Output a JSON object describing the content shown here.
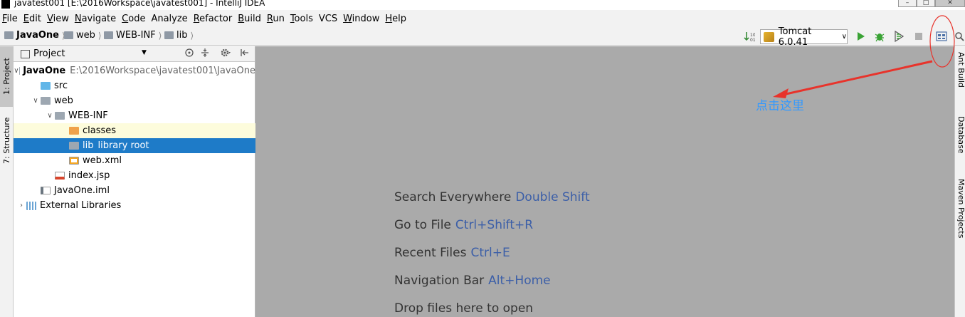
{
  "window": {
    "title": "javatest001 [E:\\2016Workspace\\javatest001] - IntelliJ IDEA"
  },
  "menu": [
    {
      "label": "File",
      "mnemonic": "F",
      "rest": "ile"
    },
    {
      "label": "Edit",
      "mnemonic": "E",
      "rest": "dit"
    },
    {
      "label": "View",
      "mnemonic": "V",
      "rest": "iew"
    },
    {
      "label": "Navigate",
      "mnemonic": "N",
      "rest": "avigate"
    },
    {
      "label": "Code",
      "mnemonic": "C",
      "rest": "ode"
    },
    {
      "label": "Analyze",
      "mnemonic": "",
      "rest": "Analyze"
    },
    {
      "label": "Refactor",
      "mnemonic": "R",
      "rest": "efactor"
    },
    {
      "label": "Build",
      "mnemonic": "B",
      "rest": "uild"
    },
    {
      "label": "Run",
      "mnemonic": "R",
      "rest": "un"
    },
    {
      "label": "Tools",
      "mnemonic": "T",
      "rest": "ools"
    },
    {
      "label": "VCS",
      "mnemonic": "",
      "rest": "VCS"
    },
    {
      "label": "Window",
      "mnemonic": "W",
      "rest": "indow"
    },
    {
      "label": "Help",
      "mnemonic": "H",
      "rest": "elp"
    }
  ],
  "breadcrumb": [
    "JavaOne",
    "web",
    "WEB-INF",
    "lib"
  ],
  "run_config": {
    "label": "Tomcat 6.0.41"
  },
  "left_tabs": [
    "1: Project",
    "7: Structure"
  ],
  "right_tabs": [
    "Ant Build",
    "Database",
    "Maven Projects"
  ],
  "project_panel": {
    "title": "Project",
    "tree": [
      {
        "label": "JavaOne",
        "extra": "E:\\2016Workspace\\javatest001\\JavaOne",
        "depth": 0,
        "arrow": "down",
        "icon": "module-folder",
        "bold": true
      },
      {
        "label": "src",
        "extra": "",
        "depth": 1,
        "arrow": "",
        "icon": "source-folder"
      },
      {
        "label": "web",
        "extra": "",
        "depth": 1,
        "arrow": "down",
        "icon": "web-folder"
      },
      {
        "label": "WEB-INF",
        "extra": "",
        "depth": 2,
        "arrow": "down",
        "icon": "folder"
      },
      {
        "label": "classes",
        "extra": "",
        "depth": 3,
        "arrow": "",
        "icon": "excluded-folder",
        "highlight": true
      },
      {
        "label": "lib",
        "extra": "library root",
        "depth": 3,
        "arrow": "",
        "icon": "library-folder",
        "selected": true
      },
      {
        "label": "web.xml",
        "extra": "",
        "depth": 3,
        "arrow": "",
        "icon": "xml-file"
      },
      {
        "label": "index.jsp",
        "extra": "",
        "depth": 2,
        "arrow": "",
        "icon": "jsp-file"
      },
      {
        "label": "JavaOne.iml",
        "extra": "",
        "depth": 1,
        "arrow": "",
        "icon": "iml-file"
      },
      {
        "label": "External Libraries",
        "extra": "",
        "depth": 0,
        "arrow": "right",
        "icon": "library-icon"
      }
    ]
  },
  "editor": {
    "hints": [
      {
        "text": "Search Everywhere",
        "key": "Double Shift"
      },
      {
        "text": "Go to File",
        "key": "Ctrl+Shift+R"
      },
      {
        "text": "Recent Files",
        "key": "Ctrl+E"
      },
      {
        "text": "Navigation Bar",
        "key": "Alt+Home"
      },
      {
        "text": "Drop files here to open",
        "key": ""
      }
    ],
    "annotation": "点击这里"
  },
  "colors": {
    "selection": "#1e7bc8",
    "editor_bg": "#aaaaaa",
    "hint_key": "#3c5fa8",
    "annotation": "#3399ff",
    "annotation_arrow": "#e8332b"
  }
}
